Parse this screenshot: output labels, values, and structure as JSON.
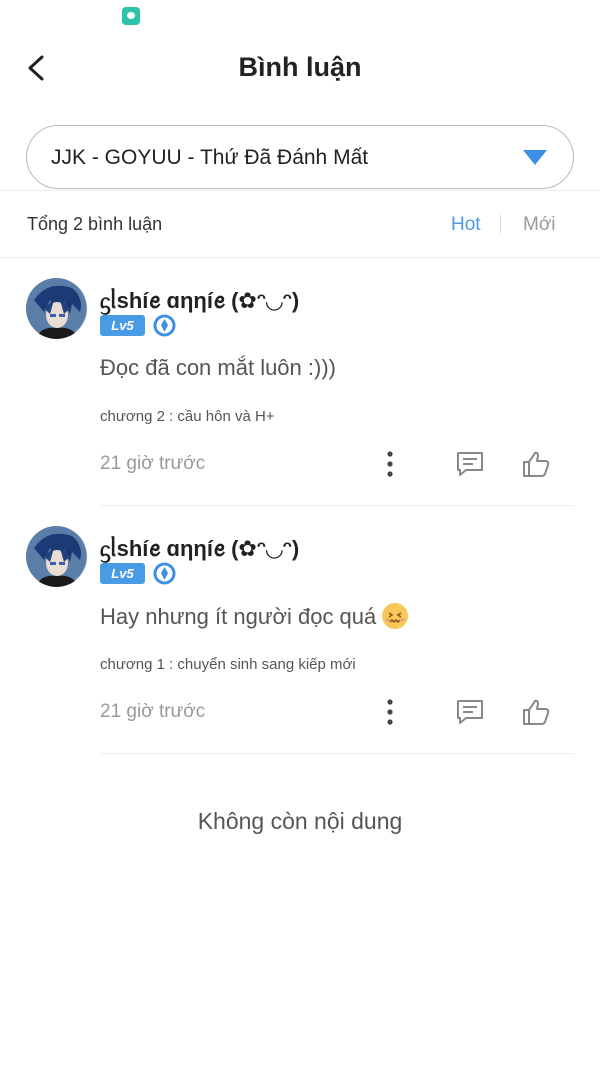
{
  "status_bar": {
    "notification_icon": "chat-notification-icon"
  },
  "header": {
    "back_icon": "chevron-left-icon",
    "title": "Bình luận"
  },
  "story_select": {
    "value": "JJK - GOYUU - Thứ Đã Đánh Mất",
    "arrow_icon": "caret-down-icon"
  },
  "toolbar": {
    "total_label": "Tổng 2 bình luận",
    "sort_hot": "Hot",
    "sort_new": "Mới"
  },
  "colors": {
    "accent": "#4a9be5",
    "muted": "#999999",
    "text": "#222222"
  },
  "comments": [
    {
      "username": "ᦓᥣshíꫀ ɑηηíꫀ (✿ᵔ◡ᵔ)",
      "level": "Lv5",
      "rank_icon": "diamond-rank-icon",
      "text": "Đọc đã con mắt luôn :)))",
      "emoji": "",
      "chapter": "chương 2 : cầu hôn và H+",
      "time": "21 giờ trước",
      "actions": [
        "more-icon",
        "reply-icon",
        "like-icon"
      ]
    },
    {
      "username": "ᦓᥣshíꫀ ɑηηíꫀ (✿ᵔ◡ᵔ)",
      "level": "Lv5",
      "rank_icon": "diamond-rank-icon",
      "text": "Hay nhưng ít người đọc quá",
      "emoji": "confounded-face-emoji",
      "chapter": "chương 1 : chuyển sinh sang kiếp mới",
      "time": "21 giờ trước",
      "actions": [
        "more-icon",
        "reply-icon",
        "like-icon"
      ]
    }
  ],
  "footer": {
    "end_text": "Không còn nội dung"
  }
}
